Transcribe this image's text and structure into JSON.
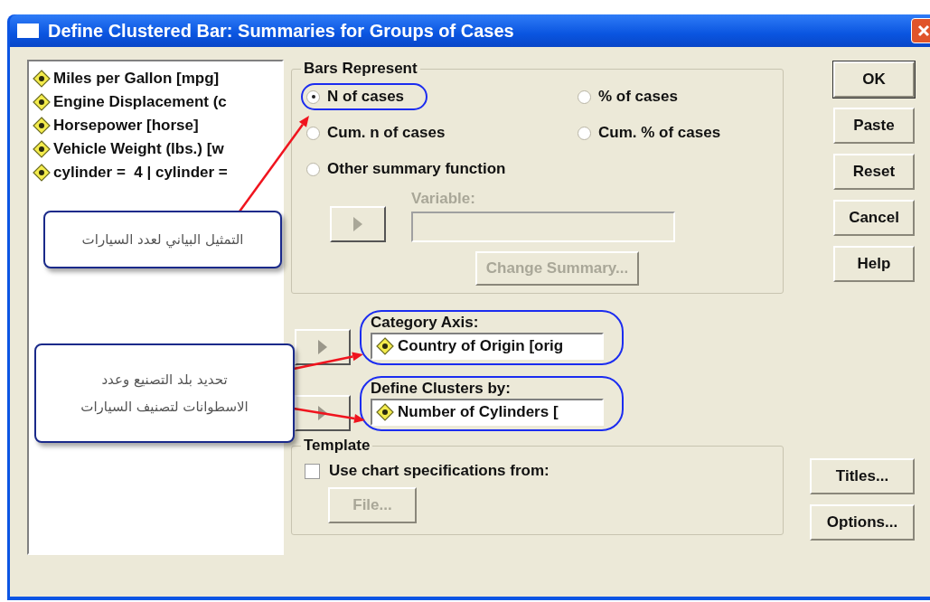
{
  "window": {
    "title": "Define Clustered Bar: Summaries for Groups of Cases"
  },
  "variables": [
    {
      "label": "Miles per Gallon [mpg]"
    },
    {
      "label": "Engine Displacement (c"
    },
    {
      "label": "Horsepower [horse]"
    },
    {
      "label": "Vehicle Weight (lbs.) [w"
    },
    {
      "label": "cylinder =  4 | cylinder ="
    }
  ],
  "bars_represent": {
    "title": "Bars Represent",
    "options": [
      {
        "label": "N of cases",
        "selected": true,
        "highlighted": true
      },
      {
        "label": "% of cases",
        "selected": false,
        "highlighted": false
      },
      {
        "label": "Cum. n of cases",
        "selected": false,
        "highlighted": false
      },
      {
        "label": "Cum. % of cases",
        "selected": false,
        "highlighted": false
      },
      {
        "label": "Other summary function",
        "selected": false,
        "highlighted": false
      }
    ],
    "variable": {
      "label": "Variable:",
      "disabled": true
    },
    "change_summary": {
      "label": "Change Summary...",
      "disabled": true
    }
  },
  "category_axis": {
    "label": "Category Axis:",
    "value": "Country of Origin [orig",
    "highlighted": true
  },
  "define_clusters": {
    "label": "Define Clusters by:",
    "value": "Number of Cylinders [",
    "highlighted": true
  },
  "template": {
    "title": "Template",
    "checkbox": {
      "label": "Use chart specifications from:",
      "checked": false
    },
    "file_button": {
      "label": "File...",
      "disabled": true
    }
  },
  "buttons": [
    {
      "label": "OK",
      "default": true
    },
    {
      "label": "Paste",
      "default": false
    },
    {
      "label": "Reset",
      "default": false
    },
    {
      "label": "Cancel",
      "default": false
    },
    {
      "label": "Help",
      "default": false
    }
  ],
  "side_buttons": [
    {
      "label": "Titles..."
    },
    {
      "label": "Options..."
    }
  ],
  "callouts": [
    {
      "lines": [
        "التمثيل البياني لعدد السيارات"
      ]
    },
    {
      "lines": [
        "تحديد بلد التصنيع وعدد",
        "الاسطوانات لتصنيف السيارات"
      ]
    }
  ]
}
